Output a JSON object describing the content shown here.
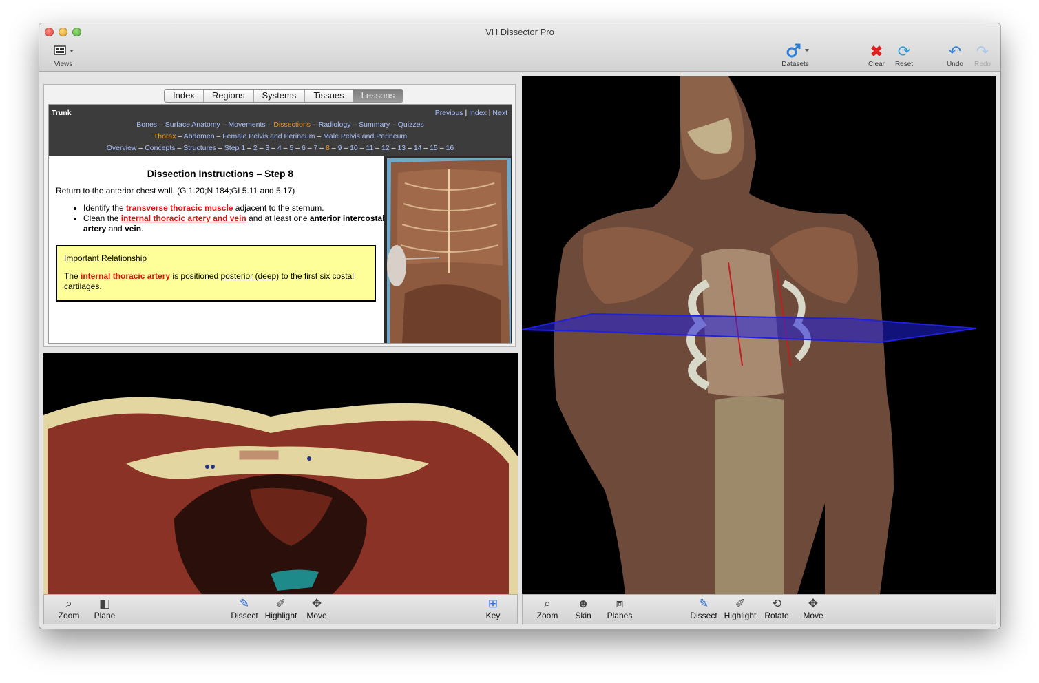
{
  "window": {
    "title": "VH Dissector Pro"
  },
  "toolbar": {
    "views": "Views",
    "datasets": "Datasets",
    "clear": "Clear",
    "reset": "Reset",
    "undo": "Undo",
    "redo": "Redo"
  },
  "tabs": [
    "Index",
    "Regions",
    "Systems",
    "Tissues",
    "Lessons"
  ],
  "lesson_nav": {
    "section": "Trunk",
    "previous": "Previous",
    "index": "Index",
    "next": "Next",
    "line1": [
      "Bones",
      "Surface Anatomy",
      "Movements",
      "Dissections",
      "Radiology",
      "Summary",
      "Quizzes"
    ],
    "line2": [
      "Thorax",
      "Abdomen",
      "Female Pelvis and Perineum",
      "Male Pelvis and Perineum"
    ],
    "line3": [
      "Overview",
      "Concepts",
      "Structures",
      "Step 1",
      "2",
      "3",
      "4",
      "5",
      "6",
      "7",
      "8",
      "9",
      "10",
      "11",
      "12",
      "13",
      "14",
      "15",
      "16"
    ]
  },
  "instructions": {
    "title": "Dissection Instructions – Step 8",
    "intro": "Return to the anterior chest wall. (G 1.20;N 184;GI 5.11 and 5.17)",
    "bullet1_pre": "Identify the ",
    "bullet1_term": "transverse thoracic muscle",
    "bullet1_post": " adjacent to the sternum.",
    "bullet2_pre": "Clean the ",
    "bullet2_term": "internal thoracic artery and vein",
    "bullet2_mid": " and at least one ",
    "bullet2_bold1": "anterior intercostal artery",
    "bullet2_and": " and ",
    "bullet2_bold2": "vein",
    "bullet2_end": ".",
    "callout_title": "Important Relationship",
    "callout_pre": "The ",
    "callout_term": "internal thoracic artery",
    "callout_mid": " is positioned ",
    "callout_link": "posterior (deep)",
    "callout_post": " to the first six costal cartilages."
  },
  "left_toolbar": {
    "zoom": "Zoom",
    "plane": "Plane",
    "dissect": "Dissect",
    "highlight": "Highlight",
    "move": "Move",
    "key": "Key"
  },
  "right_toolbar": {
    "zoom": "Zoom",
    "skin": "Skin",
    "planes": "Planes",
    "dissect": "Dissect",
    "highlight": "Highlight",
    "rotate": "Rotate",
    "move": "Move"
  },
  "colors": {
    "nav_link": "#a9c0ff",
    "nav_current": "#f0961f",
    "term_red": "#e01010",
    "callout_bg": "#ffff99",
    "plane_blue": "#2020e0"
  }
}
